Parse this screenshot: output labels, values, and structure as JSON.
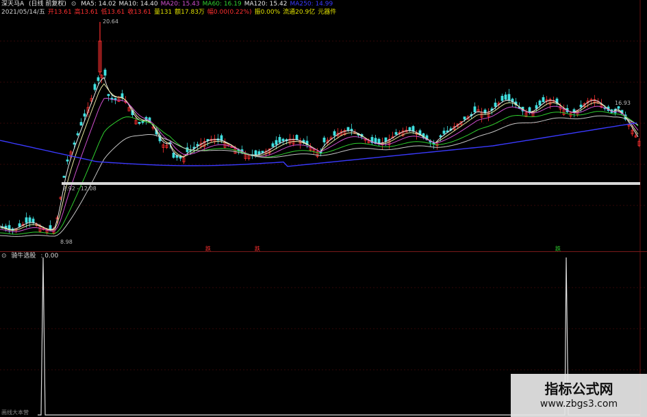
{
  "header": {
    "title": "深天马A",
    "period": "(日线 前复权)",
    "mas": [
      {
        "label": "MA5: 14.02",
        "color": "#e6e6e6"
      },
      {
        "label": "MA10: 14.40",
        "color": "#e6e6e6"
      },
      {
        "label": "MA20: 15.43",
        "color": "#d050d0"
      },
      {
        "label": "MA60: 16.19",
        "color": "#2fd02f"
      },
      {
        "label": "MA120: 15.42",
        "color": "#e6e6e6"
      },
      {
        "label": "MA250: 14.99",
        "color": "#3a3aff"
      }
    ],
    "info": [
      {
        "label": "2021/05/14/五",
        "color": "#cfcfcf"
      },
      {
        "label": "开13.61",
        "color": "#ff3030"
      },
      {
        "label": "高13.61",
        "color": "#ff3030"
      },
      {
        "label": "低13.61",
        "color": "#ff3030"
      },
      {
        "label": "收13.61",
        "color": "#ff3030"
      },
      {
        "label": "量131",
        "color": "#e0e000"
      },
      {
        "label": "额17.83万",
        "color": "#e0e000"
      },
      {
        "label": "幅0.00(0.22%)",
        "color": "#ff3030"
      },
      {
        "label": "振0.00%",
        "color": "#e0e000"
      },
      {
        "label": "流通20.9亿",
        "color": "#e0e000"
      },
      {
        "label": "元器件",
        "color": "#e0e000"
      }
    ]
  },
  "price_labels": {
    "high": "20.64",
    "low": "8.98",
    "range": "8.92 - 12.08",
    "right": "16.93"
  },
  "markers": {
    "m1": "跌",
    "m2": "跌",
    "m3": "跌"
  },
  "indicator": {
    "label": "骑牛选股",
    "value": ": 0.00",
    "bottom_text": "画线大本营"
  },
  "watermark": {
    "title": "指标公式网",
    "url": "www.zbgs3.com"
  },
  "colors": {
    "up": "#ff3030",
    "down": "#40e0e0",
    "ma5": "#e6e6e6",
    "ma10": "#e6e6a0",
    "ma20": "#d050d0",
    "ma60": "#2fd02f",
    "ma250": "#3a3aff",
    "grid": "#6a1010"
  }
}
